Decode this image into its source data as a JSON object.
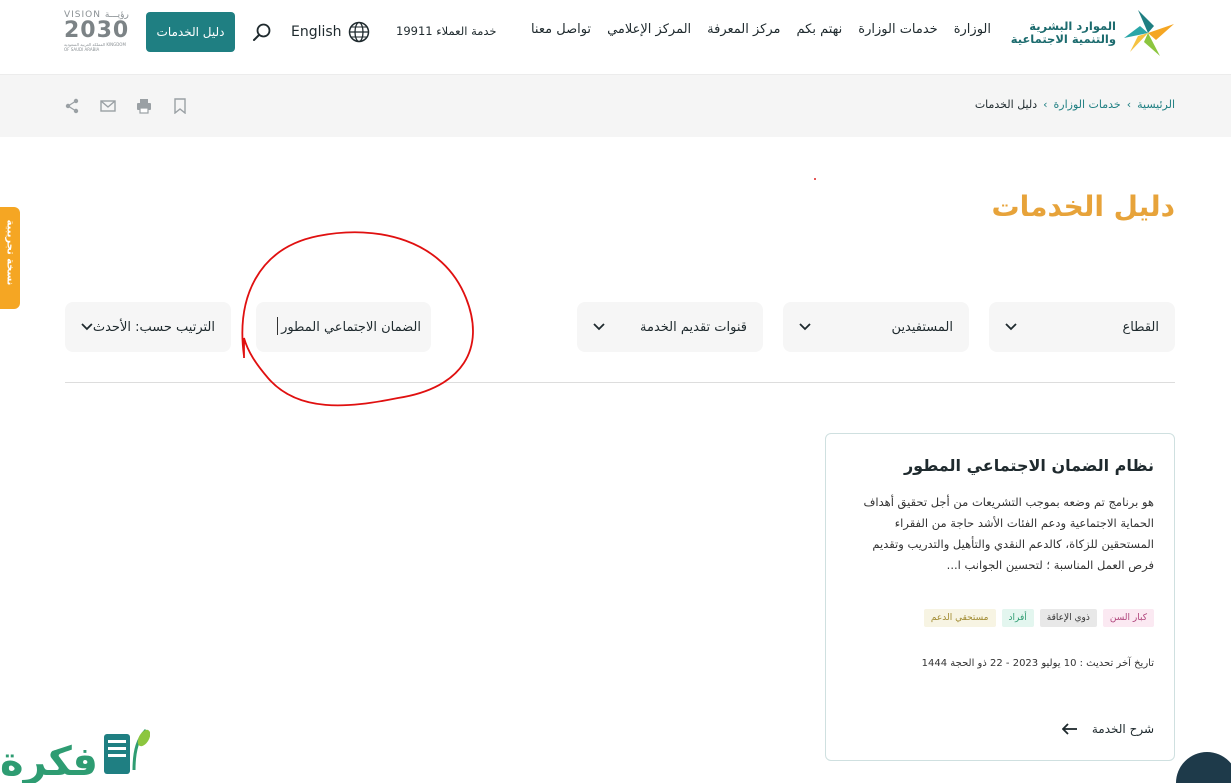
{
  "header": {
    "logo_line1": "الموارد البشرية",
    "logo_line2": "والتنمية الاجتماعية",
    "nav": [
      "الوزارة",
      "خدمات الوزارة",
      "نهتم بكم",
      "مركز المعرفة",
      "المركز الإعلامي",
      "تواصل معنا"
    ],
    "customer_service": "خدمة العملاء 19911",
    "language": "English",
    "guide_button": "دليل الخدمات",
    "vision_top": "VISION رؤيـــة",
    "vision_year": "2030",
    "vision_sub": "المملكة العربية السعودية KINGDOM OF SAUDI ARABIA"
  },
  "breadcrumb": {
    "home": "الرئيسية",
    "services": "خدمات الوزارة",
    "current": "دليل الخدمات",
    "separator": "‹"
  },
  "side_tab": "نسخة تجريبية",
  "page_title": "دليل الخدمات",
  "filters": {
    "sector": "القطاع",
    "beneficiaries": "المستفيدين",
    "channels": "قنوات تقديم الخدمة",
    "search_value": "الضمان الاجتماعي المطور",
    "sort": "الترتيب حسب: الأحدث"
  },
  "card": {
    "title": "نظام الضمان الاجتماعي المطور",
    "description": "هو برنامج تم وضعه بموجب التشريعات من أجل تحقيق أهداف الحماية الاجتماعية ودعم الفئات الأشد حاجة من الفقراء المستحقين للزكاة، كالدعم النقدي والتأهيل والتدريب وتقديم فرص العمل المناسبة ؛ لتحسين الجوانب ا...",
    "tags": [
      "كبار السن",
      "ذوي الإعاقة",
      "أفراد",
      "مستحقي الدعم"
    ],
    "last_update": "تاريخ آخر تحديث : 10 يوليو 2023 - 22 ذو الحجة 1444",
    "link": "شرح الخدمة"
  },
  "watermark": "فكرة",
  "colors": {
    "teal": "#1f7f82",
    "orange": "#e7a33a",
    "annotation_red": "#e01010"
  }
}
